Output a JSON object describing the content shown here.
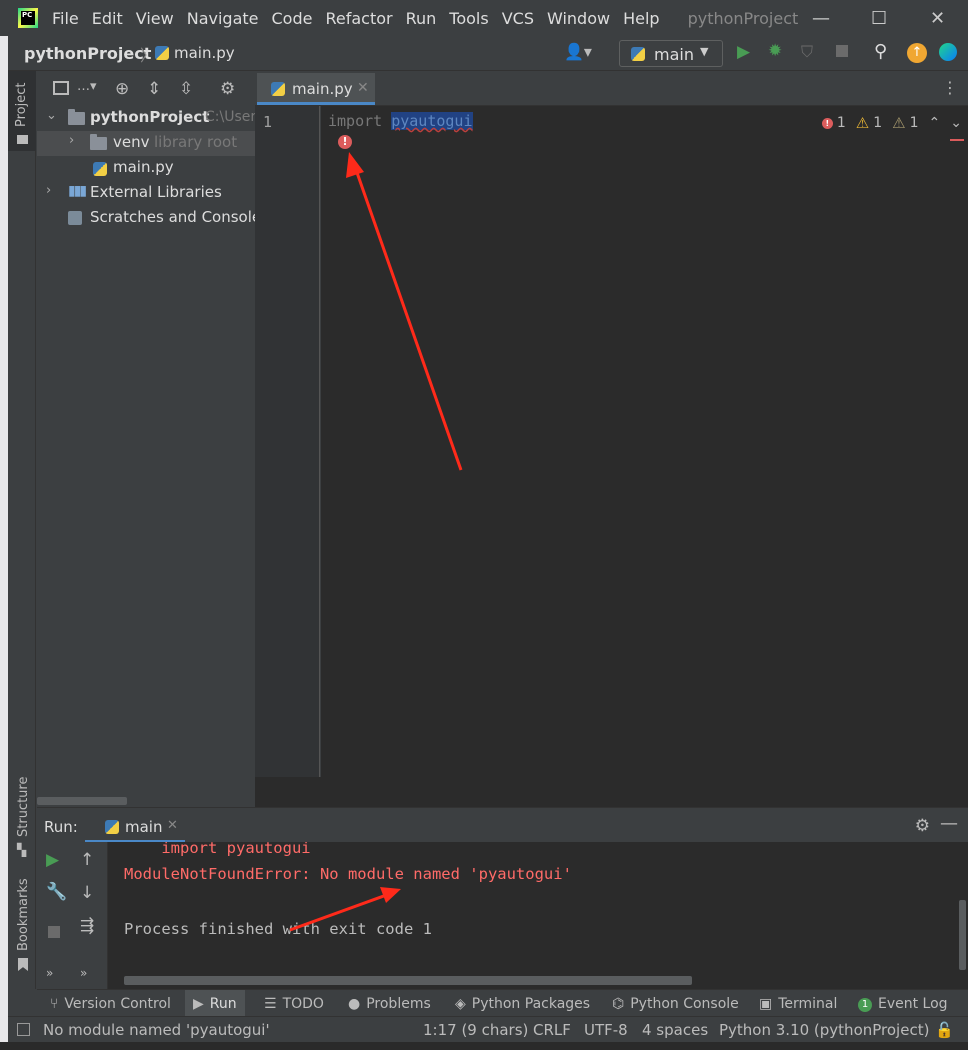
{
  "app": {
    "logo_text": "PC",
    "title": "pythonProject",
    "menu": [
      "File",
      "Edit",
      "View",
      "Navigate",
      "Code",
      "Refactor",
      "Run",
      "Tools",
      "VCS",
      "Window",
      "Help"
    ]
  },
  "navbar": {
    "project": "pythonProject",
    "separator": "〉",
    "file": "main.py",
    "run_config": "main"
  },
  "left_stripe": {
    "project": "Project",
    "structure": "Structure",
    "bookmarks": "Bookmarks"
  },
  "project_tree": {
    "rows": [
      {
        "label": "pythonProject",
        "suffix": "C:\\User"
      },
      {
        "label": "venv",
        "suffix": "library root"
      },
      {
        "label": "main.py",
        "suffix": ""
      },
      {
        "label": "External Libraries",
        "suffix": ""
      },
      {
        "label": "Scratches and Consoles",
        "suffix": ""
      }
    ]
  },
  "editor": {
    "tab": "main.py",
    "line_number": "1",
    "keyword": "import",
    "module": "pyautogui",
    "inspections": {
      "errors": "1",
      "warnings": "1",
      "weak_warnings": "1"
    }
  },
  "run_window": {
    "label": "Run:",
    "tab": "main",
    "console": [
      {
        "text": "    import pyautogui",
        "kind": "err"
      },
      {
        "text": "ModuleNotFoundError: No module named 'pyautogui'",
        "kind": "err"
      },
      {
        "text": "Process finished with exit code 1",
        "kind": "norm"
      }
    ]
  },
  "tool_tabs": [
    "Version Control",
    "Run",
    "TODO",
    "Problems",
    "Python Packages",
    "Python Console",
    "Terminal",
    "Event Log"
  ],
  "event_log_count": "1",
  "status_bar": {
    "message": "No module named 'pyautogui'",
    "position": "1:17 (9 chars)",
    "line_sep": "CRLF",
    "encoding": "UTF-8",
    "indent": "4 spaces",
    "interpreter": "Python 3.10 (pythonProject)"
  },
  "colors": {
    "accent": "#4a88c7",
    "error": "#ff6b68",
    "annotation_arrow": "#ff2a1a",
    "run_green": "#499c54"
  }
}
